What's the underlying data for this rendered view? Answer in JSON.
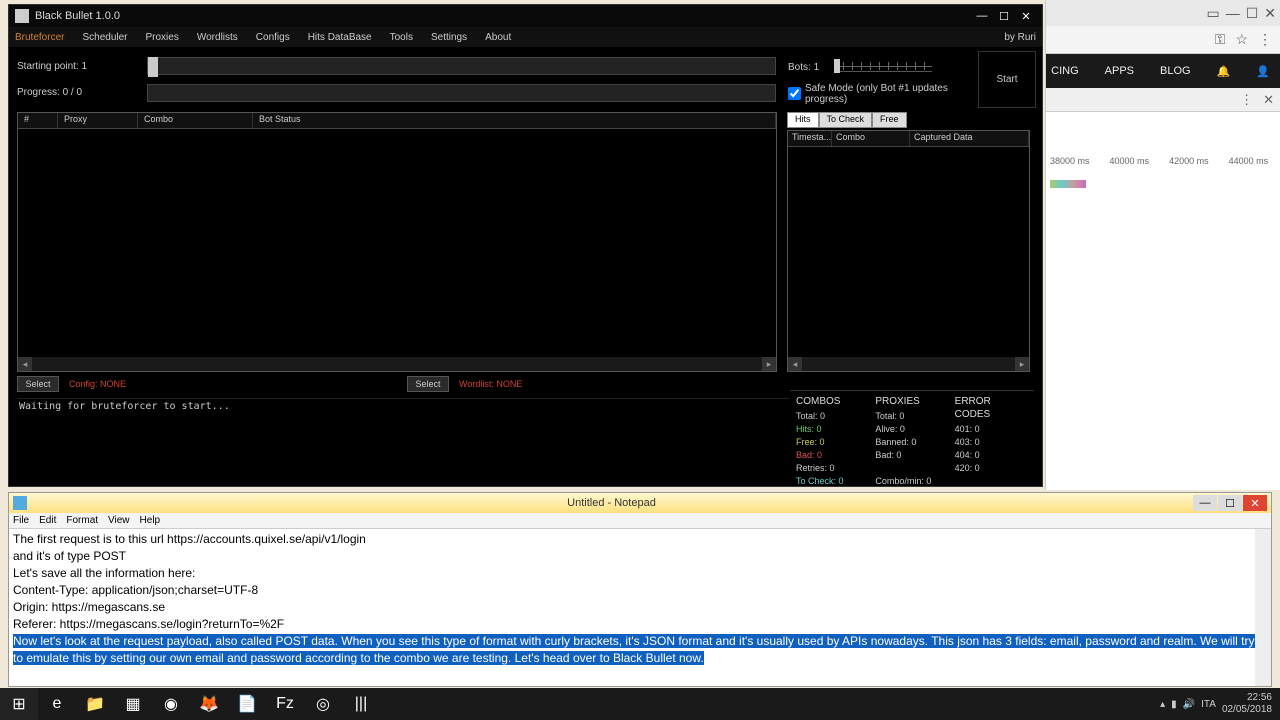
{
  "blackbullet": {
    "title": "Black Bullet 1.0.0",
    "byline": "by Ruri",
    "menu": [
      "Bruteforcer",
      "Scheduler",
      "Proxies",
      "Wordlists",
      "Configs",
      "Hits DataBase",
      "Tools",
      "Settings",
      "About"
    ],
    "starting_point_label": "Starting point:",
    "starting_point_value": "1",
    "progress_label": "Progress:",
    "progress_value": "0 / 0",
    "bots_label": "Bots:",
    "bots_value": "1",
    "safe_mode_label": "Safe Mode (only Bot #1 updates progress)",
    "start_label": "Start",
    "table_cols": {
      "num": "#",
      "proxy": "Proxy",
      "combo": "Combo",
      "bot": "Bot Status"
    },
    "hit_tabs": [
      "Hits",
      "To Check",
      "Free"
    ],
    "hits_cols": {
      "t": "Timesta...",
      "c": "Combo",
      "d": "Captured Data"
    },
    "select_label": "Select",
    "config_label": "Config: NONE",
    "wordlist_label": "Wordlist: NONE",
    "log_text": "Waiting for bruteforcer to start...",
    "stats": {
      "combos_hdr": "COMBOS",
      "combos": {
        "total": "Total: 0",
        "hits": "Hits: 0",
        "free": "Free: 0",
        "bad": "Bad: 0",
        "retries": "Retries: 0",
        "tocheck": "To Check: 0"
      },
      "proxies_hdr": "PROXIES",
      "proxies": {
        "total": "Total: 0",
        "alive": "Alive: 0",
        "banned": "Banned: 0",
        "bad": "Bad: 0",
        "cpm": "Combo/min:  0"
      },
      "errors_hdr": "ERROR CODES",
      "errors": {
        "e401": "401: 0",
        "e403": "403: 0",
        "e404": "404: 0",
        "e420": "420: 0"
      }
    }
  },
  "notepad": {
    "title": "Untitled - Notepad",
    "menu": [
      "File",
      "Edit",
      "Format",
      "View",
      "Help"
    ],
    "lines_plain": "The first request is to this url https://accounts.quixel.se/api/v1/login\nand it's of type POST\nLet's save all the information here:\nContent-Type: application/json;charset=UTF-8\nOrigin: https://megascans.se\nReferer: https://megascans.se/login?returnTo=%2F\n",
    "lines_selected": "Now let's look at the request payload, also called POST data. When you see this type of format with curly brackets, it's JSON format and it's usually used by APIs nowadays. This json has 3 fields: email, password and realm. We will try to emulate this by setting our own email and password according to the combo we are testing. Let's head over to Black Bullet now."
  },
  "browser": {
    "nav": [
      "CING",
      "APPS",
      "BLOG"
    ],
    "waterfall_ticks": [
      "38000 ms",
      "40000 ms",
      "42000 ms",
      "44000 ms"
    ]
  },
  "taskbar": {
    "time": "22:56",
    "date": "02/05/2018",
    "lang": "ITA"
  }
}
